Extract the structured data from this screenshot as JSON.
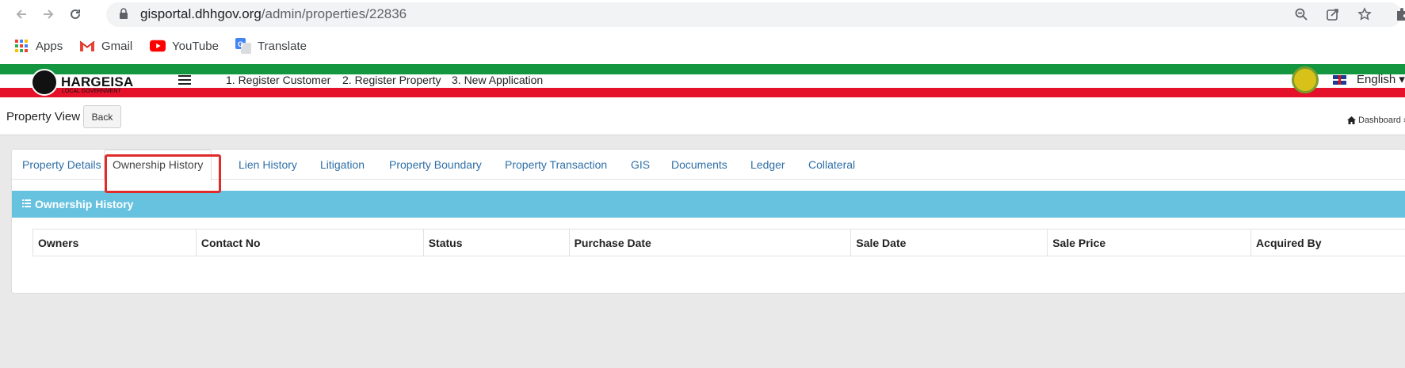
{
  "browser": {
    "url_host": "gisportal.dhhgov.org",
    "url_path": "/admin/properties/22836",
    "bookmarks": [
      {
        "label": "Apps",
        "icon": "apps-grid-icon"
      },
      {
        "label": "Gmail",
        "icon": "gmail-icon"
      },
      {
        "label": "YouTube",
        "icon": "youtube-icon"
      },
      {
        "label": "Translate",
        "icon": "translate-icon"
      }
    ]
  },
  "app": {
    "logo_text": "HARGEISA",
    "logo_sub": "LOCAL GOVERNMENT",
    "menu_links": [
      "1. Register Customer",
      "2. Register Property",
      "3. New Application"
    ],
    "language": "English",
    "colors": {
      "green": "#149641",
      "red": "#e5102a",
      "panel": "#67c2e0",
      "link": "#2f6fa7"
    }
  },
  "page": {
    "title": "Property View",
    "back_label": "Back",
    "breadcrumb": "Dashboard"
  },
  "tabs": [
    "Property Details",
    "Ownership History",
    "Lien History",
    "Litigation",
    "Property Boundary",
    "Property Transaction",
    "GIS",
    "Documents",
    "Ledger",
    "Collateral"
  ],
  "active_tab": "Ownership History",
  "panel": {
    "title": "Ownership History",
    "columns": [
      "Owners",
      "Contact No",
      "Status",
      "Purchase Date",
      "Sale Date",
      "Sale Price",
      "Acquired By"
    ]
  }
}
